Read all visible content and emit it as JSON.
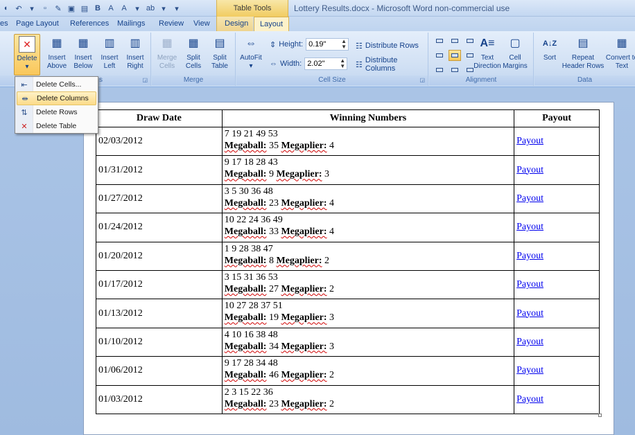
{
  "window": {
    "title": "Lottery Results.docx - Microsoft Word non-commercial use",
    "contextual_tab_group": "Table Tools"
  },
  "tabs": [
    "es",
    "Page Layout",
    "References",
    "Mailings",
    "Review",
    "View",
    "Design",
    "Layout"
  ],
  "active_tab": "Layout",
  "ribbon": {
    "rows_columns": {
      "delete_label": "Delete",
      "insert_above": "Insert Above",
      "insert_below": "Insert Below",
      "insert_left": "Insert Left",
      "insert_right": "Insert Right",
      "label_fragment": "s"
    },
    "merge": {
      "merge_cells": "Merge Cells",
      "split_cells": "Split Cells",
      "split_table": "Split Table",
      "label": "Merge"
    },
    "cell_size": {
      "autofit": "AutoFit",
      "height_label": "Height:",
      "height_value": "0.19\"",
      "width_label": "Width:",
      "width_value": "2.02\"",
      "distribute_rows": "Distribute Rows",
      "distribute_columns": "Distribute Columns",
      "label": "Cell Size"
    },
    "alignment": {
      "text_direction": "Text Direction",
      "cell_margins": "Cell Margins",
      "label": "Alignment"
    },
    "data": {
      "sort": "Sort",
      "repeat_header_rows": "Repeat Header Rows",
      "convert_to_text": "Convert to Text",
      "label": "Data"
    }
  },
  "delete_menu": {
    "items": [
      {
        "label": "Delete Cells...",
        "icon": "delete-cells-icon"
      },
      {
        "label": "Delete Columns",
        "icon": "delete-columns-icon"
      },
      {
        "label": "Delete Rows",
        "icon": "delete-rows-icon"
      },
      {
        "label": "Delete Table",
        "icon": "delete-table-icon"
      }
    ],
    "highlighted_index": 1
  },
  "table": {
    "headers": [
      "Draw Date",
      "Winning Numbers",
      "Payout"
    ],
    "megaball_label": "Megaball:",
    "megaplier_label": "Megaplier:",
    "rows": [
      {
        "date": "02/03/2012",
        "numbers": "7 19 21 49 53",
        "megaball": "35",
        "megaplier": "4",
        "payout": "Payout"
      },
      {
        "date": "01/31/2012",
        "numbers": "9 17 18 28 43",
        "megaball": "9",
        "megaplier": "3",
        "payout": "Payout"
      },
      {
        "date": "01/27/2012",
        "numbers": "3 5 30 36 48",
        "megaball": "23",
        "megaplier": "4",
        "payout": "Payout"
      },
      {
        "date": "01/24/2012",
        "numbers": "10 22 24 36 49",
        "megaball": "33",
        "megaplier": "4",
        "payout": "Payout"
      },
      {
        "date": "01/20/2012",
        "numbers": "1 9 28 38 47",
        "megaball": "8",
        "megaplier": "2",
        "payout": "Payout"
      },
      {
        "date": "01/17/2012",
        "numbers": "3 15 31 36 53",
        "megaball": "27",
        "megaplier": "2",
        "payout": "Payout"
      },
      {
        "date": "01/13/2012",
        "numbers": "10 27 28 37 51",
        "megaball": "19",
        "megaplier": "3",
        "payout": "Payout"
      },
      {
        "date": "01/10/2012",
        "numbers": "4 10 16 38 48",
        "megaball": "34",
        "megaplier": "3",
        "payout": "Payout"
      },
      {
        "date": "01/06/2012",
        "numbers": "9 17 28 34 48",
        "megaball": "46",
        "megaplier": "2",
        "payout": "Payout"
      },
      {
        "date": "01/03/2012",
        "numbers": "2 3 15 22 36",
        "megaball": "23",
        "megaplier": "2",
        "payout": "Payout"
      }
    ]
  },
  "colors": {
    "ribbon_text": "#15428b",
    "highlight": "#f9c75a",
    "link": "#0000ee"
  }
}
